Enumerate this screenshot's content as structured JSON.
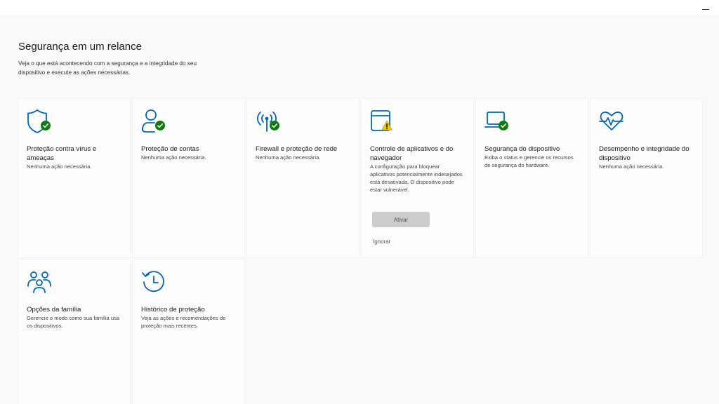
{
  "page": {
    "title": "Segurança em um relance",
    "description": "Veja o que está acontecendo com a segurança e a integridade do seu dispositivo e execute as ações necessárias."
  },
  "tiles": [
    {
      "title": "Proteção contra vírus e ameaças",
      "subtitle": "Nenhuma ação necessária.",
      "icon": "shield-icon",
      "status": "ok"
    },
    {
      "title": "Proteção de contas",
      "subtitle": "Nenhuma ação necessária.",
      "icon": "account-icon",
      "status": "ok"
    },
    {
      "title": "Firewall e proteção de rede",
      "subtitle": "Nenhuma ação necessária.",
      "icon": "wifi-antenna-icon",
      "status": "ok"
    },
    {
      "title": "Controle de aplicativos e do navegador",
      "subtitle": "A configuração para bloquear aplicativos potencialmente indesejados está desativada. O dispositivo pode estar vulnerável.",
      "icon": "app-browser-icon",
      "status": "warning",
      "action_label": "Ativar",
      "dismiss_label": "Ignorar"
    },
    {
      "title": "Segurança do dispositivo",
      "subtitle": "Exiba o status e gerencie os recursos de segurança do hardware.",
      "icon": "laptop-icon",
      "status": "ok"
    },
    {
      "title": "Desempenho e integridade do dispositivo",
      "subtitle": "Nenhuma ação necessária.",
      "icon": "heart-pulse-icon",
      "status": "none"
    },
    {
      "title": "Opções da família",
      "subtitle": "Gerencie o modo como sua família usa os dispositivos.",
      "icon": "family-icon",
      "status": "none"
    },
    {
      "title": "Histórico de proteção",
      "subtitle": "Veja as ações e recomendações de proteção mais recentes.",
      "icon": "history-icon",
      "status": "none"
    }
  ],
  "colors": {
    "accent": "#0067c0",
    "ok": "#0f7b0f",
    "warning": "#f2c500"
  }
}
